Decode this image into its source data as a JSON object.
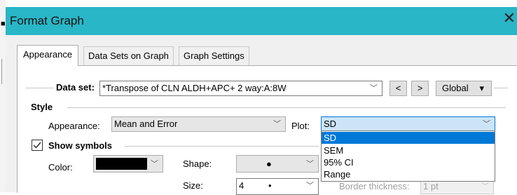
{
  "window": {
    "title": "Format Graph",
    "close_glyph": "✕"
  },
  "edge": {
    "dot": "■"
  },
  "tabs": [
    {
      "label": "Appearance",
      "active": true
    },
    {
      "label": "Data Sets on Graph",
      "active": false
    },
    {
      "label": "Graph Settings",
      "active": false
    }
  ],
  "dataset": {
    "label": "Data set:",
    "value": "*Transpose of CLN ALDH+APC+ 2 way:A:8W",
    "prev_label": "<",
    "next_label": ">",
    "scope_value": "Global",
    "scope_arrow": "▾"
  },
  "style": {
    "section_label": "Style",
    "appearance_label": "Appearance:",
    "appearance_value": "Mean and Error",
    "plot_label": "Plot:",
    "plot_value": "SD",
    "plot_options": [
      "SD",
      "SEM",
      "95% CI",
      "Range"
    ],
    "plot_selected_index": 0
  },
  "symbols": {
    "section_label": "Show symbols",
    "checked": true,
    "color_label": "Color:",
    "color_value": "#000000",
    "shape_label": "Shape:",
    "shape_glyph": "●",
    "size_label": "Size:",
    "size_value": "4",
    "size_glyph": "•",
    "border_label": "Border thickness:",
    "border_value": "1 pt"
  },
  "icons": {
    "chevron": "﹀"
  }
}
